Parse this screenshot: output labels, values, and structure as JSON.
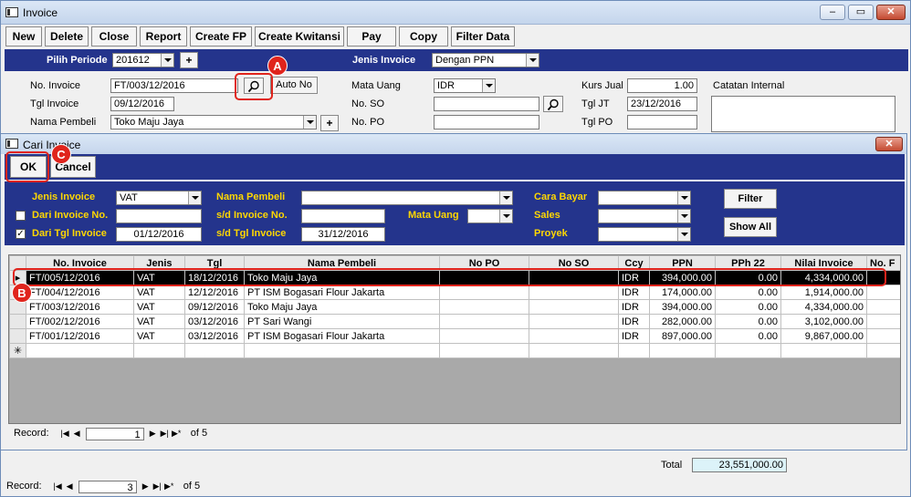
{
  "window": {
    "title": "Invoice"
  },
  "toolbar": {
    "new": "New",
    "delete": "Delete",
    "close": "Close",
    "report": "Report",
    "create_fp": "Create FP",
    "create_kwitansi": "Create Kwitansi",
    "pay": "Pay",
    "copy": "Copy",
    "filter_data": "Filter Data"
  },
  "period": {
    "label": "Pilih Periode",
    "value": "201612",
    "plus": "+",
    "jenis_label": "Jenis Invoice",
    "jenis_value": "Dengan PPN"
  },
  "header": {
    "no_invoice_label": "No. Invoice",
    "no_invoice_value": "FT/003/12/2016",
    "auto_no": "Auto No",
    "tgl_invoice_label": "Tgl Invoice",
    "tgl_invoice_value": "09/12/2016",
    "nama_pembeli_label": "Nama Pembeli",
    "nama_pembeli_value": "Toko Maju Jaya",
    "plus": "+",
    "mata_uang_label": "Mata Uang",
    "mata_uang_value": "IDR",
    "no_so_label": "No. SO",
    "no_so_value": "",
    "no_po_label": "No. PO",
    "no_po_value": "",
    "kurs_jual_label": "Kurs Jual",
    "kurs_jual_value": "1.00",
    "tgl_jt_label": "Tgl JT",
    "tgl_jt_value": "23/12/2016",
    "tgl_po_label": "Tgl PO",
    "tgl_po_value": "",
    "catatan_label": "Catatan Internal"
  },
  "dialog": {
    "title": "Cari Invoice",
    "ok": "OK",
    "cancel": "Cancel",
    "jenis_invoice_label": "Jenis Invoice",
    "jenis_invoice_value": "VAT",
    "nama_pembeli_label": "Nama Pembeli",
    "nama_pembeli_value": "",
    "cara_bayar_label": "Cara Bayar",
    "dari_invoice_label": "Dari Invoice No.",
    "sd_invoice_label": "s/d  Invoice No.",
    "mata_uang_label": "Mata Uang",
    "sales_label": "Sales",
    "dari_tgl_label": "Dari Tgl Invoice",
    "dari_tgl_value": "01/12/2016",
    "sd_tgl_label": "s/d Tgl Invoice",
    "sd_tgl_value": "31/12/2016",
    "proyek_label": "Proyek",
    "filter": "Filter",
    "show_all": "Show All",
    "columns": [
      "No. Invoice",
      "Jenis",
      "Tgl",
      "Nama Pembeli",
      "No PO",
      "No SO",
      "Ccy",
      "PPN",
      "PPh 22",
      "Nilai Invoice",
      "No. F"
    ],
    "rows": [
      [
        "FT/005/12/2016",
        "VAT",
        "18/12/2016",
        "Toko Maju Jaya",
        "",
        "",
        "IDR",
        "394,000.00",
        "0.00",
        "4,334,000.00",
        ""
      ],
      [
        "FT/004/12/2016",
        "VAT",
        "12/12/2016",
        "PT ISM Bogasari Flour Jakarta",
        "",
        "",
        "IDR",
        "174,000.00",
        "0.00",
        "1,914,000.00",
        ""
      ],
      [
        "FT/003/12/2016",
        "VAT",
        "09/12/2016",
        "Toko Maju Jaya",
        "",
        "",
        "IDR",
        "394,000.00",
        "0.00",
        "4,334,000.00",
        ""
      ],
      [
        "FT/002/12/2016",
        "VAT",
        "03/12/2016",
        "PT Sari Wangi",
        "",
        "",
        "IDR",
        "282,000.00",
        "0.00",
        "3,102,000.00",
        ""
      ],
      [
        "FT/001/12/2016",
        "VAT",
        "03/12/2016",
        "PT ISM Bogasari Flour Jakarta",
        "",
        "",
        "IDR",
        "897,000.00",
        "0.00",
        "9,867,000.00",
        ""
      ]
    ],
    "record_label": "Record:",
    "record_value": "1",
    "record_of": "of  5"
  },
  "footer": {
    "total_label": "Total",
    "total_value": "23,551,000.00",
    "record_label": "Record:",
    "record_value": "3",
    "record_of": "of  5"
  },
  "callouts": {
    "a": "A",
    "b": "B",
    "c": "C"
  }
}
